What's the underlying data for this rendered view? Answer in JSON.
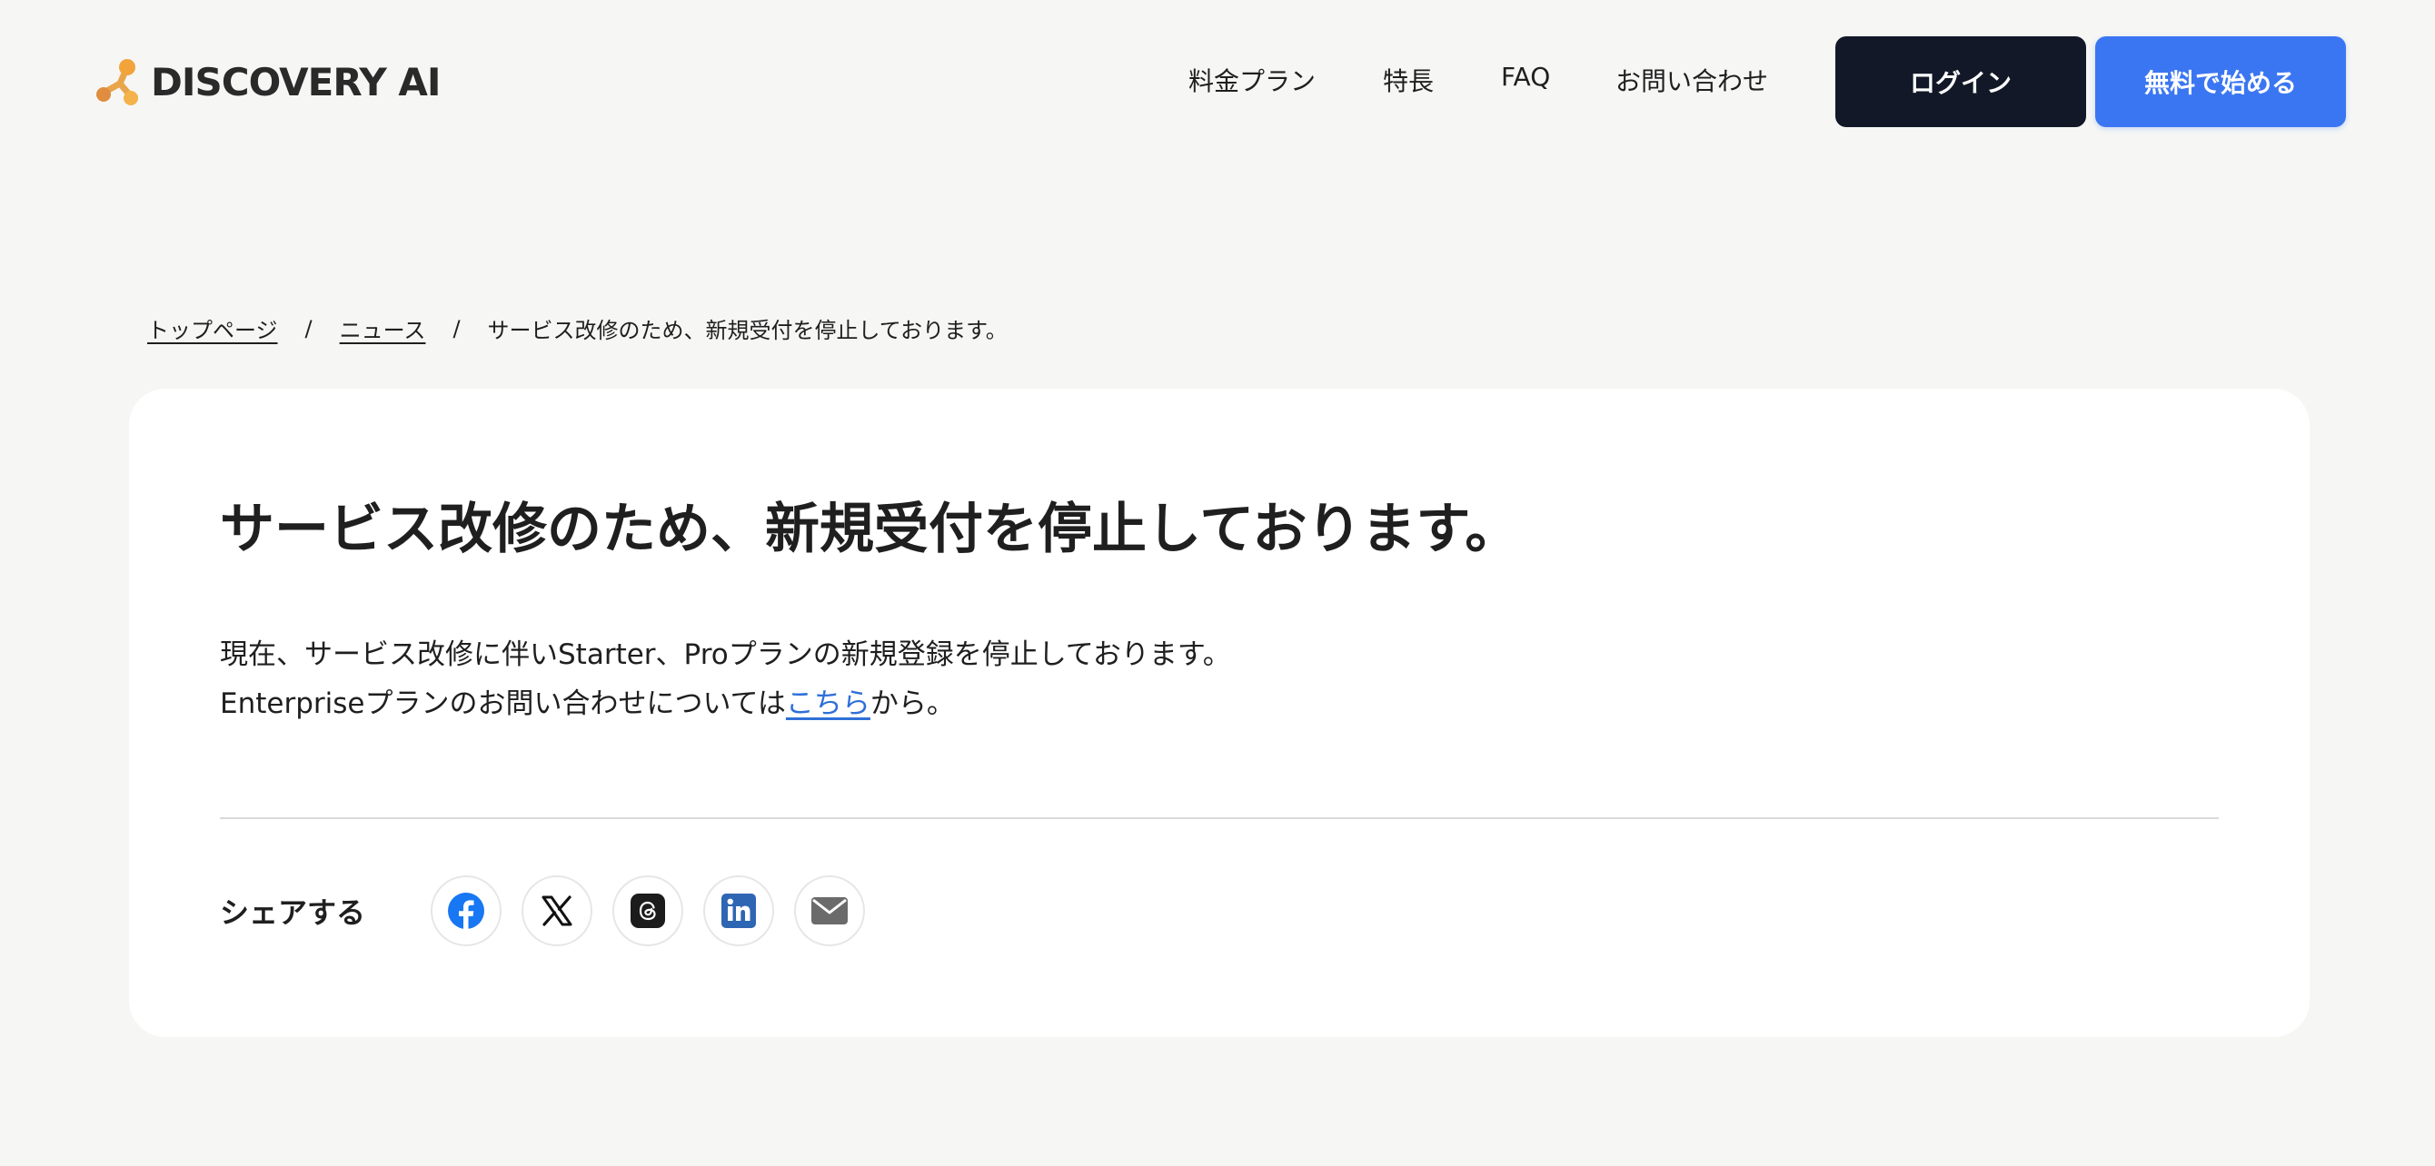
{
  "header": {
    "logo_text": "DISCOVERY AI",
    "nav": [
      {
        "label": "料金プラン"
      },
      {
        "label": "特長"
      },
      {
        "label": "FAQ"
      },
      {
        "label": "お問い合わせ"
      }
    ],
    "login_label": "ログイン",
    "start_label": "無料で始める"
  },
  "breadcrumb": {
    "items": [
      "トップページ",
      "ニュース"
    ],
    "separator": "/",
    "current": "サービス改修のため、新規受付を停止しております。"
  },
  "article": {
    "title": "サービス改修のため、新規受付を停止しております。",
    "line1": "現在、サービス改修に伴いStarter、Proプランの新規登録を停止しております。",
    "line2_before": "Enterpriseプランのお問い合わせについては",
    "line2_link": "こちら",
    "line2_after": "から。"
  },
  "share": {
    "label": "シェアする",
    "icons": [
      "facebook-icon",
      "x-icon",
      "threads-icon",
      "linkedin-icon",
      "mail-icon"
    ]
  },
  "colors": {
    "background": "#f6f6f5",
    "login_button": "#121827",
    "start_button": "#3b76f2",
    "link": "#2f6fd8",
    "logo_orange": "#f2a33a",
    "logo_brown": "#d9843b"
  }
}
